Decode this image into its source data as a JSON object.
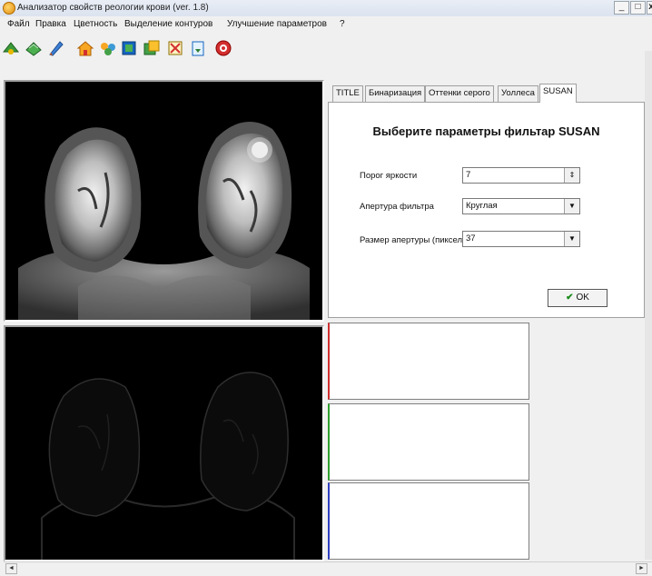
{
  "window": {
    "title": "Анализатор свойств реологии крови (ver. 1.8)",
    "buttons": {
      "minimize": "_",
      "maximize": "□",
      "close": "x"
    }
  },
  "menu": [
    "Файл",
    "Правка",
    "Цветность",
    "Выделение контуров",
    "Улучшение параметров",
    "?"
  ],
  "toolbar_icons": [
    "open-icon",
    "layers-icon",
    "brush-icon",
    "home-icon",
    "people-icon",
    "book-icon",
    "image-edit-icon",
    "tools-icon",
    "export-icon",
    "help-icon"
  ],
  "tabs": [
    {
      "label": "TITLE",
      "active": false
    },
    {
      "label": "Бинаризация",
      "active": false
    },
    {
      "label": "Оттенки серого",
      "active": false
    },
    {
      "label": "Уоллеса",
      "active": false
    },
    {
      "label": "SUSAN",
      "active": true
    }
  ],
  "susan_panel": {
    "heading": "Выберите параметры фильтар SUSAN",
    "threshold": {
      "label": "Порог яркости",
      "value": "7"
    },
    "aperture": {
      "label": "Апертура фильтра",
      "value": "Круглая"
    },
    "aperture_size": {
      "label": "Размер апертуры (пикселов)",
      "value": "37"
    },
    "ok_label": "OK"
  },
  "plot_axis_colors": [
    "#d03030",
    "#30a030",
    "#3040c0"
  ]
}
